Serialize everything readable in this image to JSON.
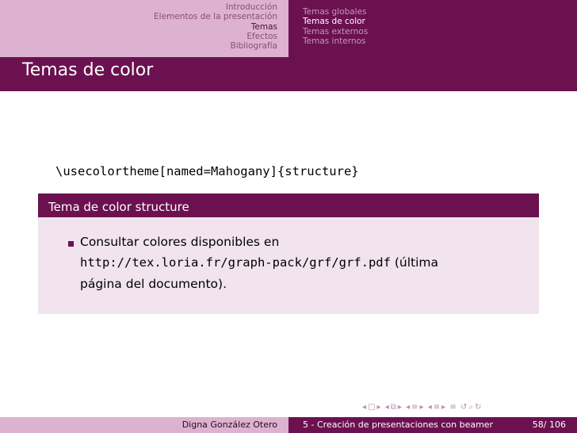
{
  "header": {
    "sections": [
      "Introducción",
      "Elementos de la presentación",
      "Temas",
      "Efectos",
      "Bibliografía"
    ],
    "subsections": [
      "Temas globales",
      "Temas de color",
      "Temas externos",
      "Temas internos"
    ]
  },
  "frame": {
    "title": "Temas de color",
    "code": "\\usecolortheme[named=Mahogany]{structure}"
  },
  "block": {
    "title": "Tema de color structure",
    "item_line1": "Consultar colores disponibles en",
    "item_url": "http://tex.loria.fr/graph-pack/grf/grf.pdf",
    "item_after_url": " (última",
    "item_line3": "página del documento)."
  },
  "nav_icons": [
    "nav-prev-slide-icon",
    "nav-slide-icon",
    "nav-next-slide-icon",
    "nav-prev-frame-icon",
    "nav-frame-icon",
    "nav-next-frame-icon",
    "nav-prev-subsection-icon",
    "nav-subsection-icon",
    "nav-next-subsection-icon",
    "nav-prev-section-icon",
    "nav-section-icon",
    "nav-next-section-icon",
    "nav-align-icon",
    "nav-back-icon",
    "nav-search-icon"
  ],
  "footer": {
    "author": "Digna González Otero",
    "title": "5 - Creación de presentaciones con beamer",
    "page": "58/ 106"
  },
  "colors": {
    "mahogany": "#6b1150",
    "header_left": "#dcb2d0",
    "block_body": "#f1e4ee"
  }
}
